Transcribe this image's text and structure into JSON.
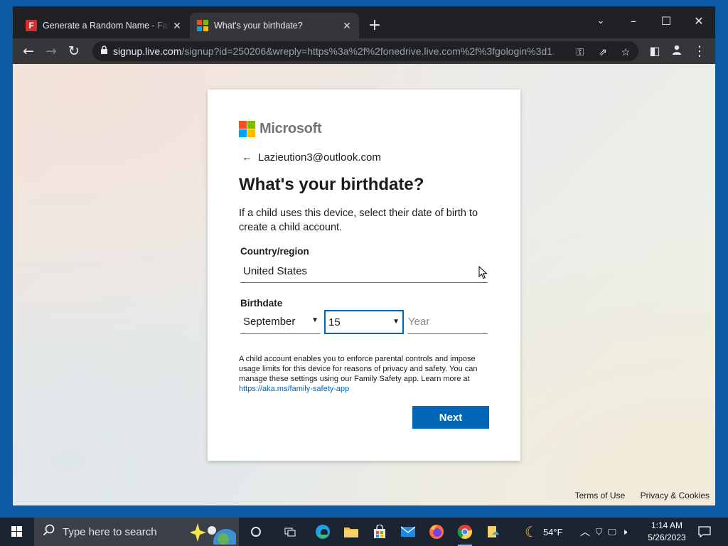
{
  "browser": {
    "tabs": [
      {
        "title": "Generate a Random Name - Fake Name Generator",
        "favicon": "fakename-icon"
      },
      {
        "title": "What's your birthdate?",
        "favicon": "microsoft-icon"
      }
    ],
    "url_host": "signup.live.com",
    "url_rest": "/signup?id=250206&wreply=https%3a%2f%2fonedrive.live.com%2f%3fgologin%3d1..."
  },
  "page": {
    "brand": "Microsoft",
    "account_email": "Lazieution3@outlook.com",
    "heading": "What's your birthdate?",
    "description": "If a child uses this device, select their date of birth to create a child account.",
    "country_label": "Country/region",
    "country_value": "United States",
    "birthdate_label": "Birthdate",
    "month_value": "September",
    "day_value": "15",
    "year_placeholder": "Year",
    "note_text": "A child account enables you to enforce parental controls and impose usage limits for this device for reasons of privacy and safety. You can manage these settings using our Family Safety app. Learn more at",
    "note_link": "https://aka.ms/family-safety-app",
    "next_button": "Next",
    "footer": {
      "terms": "Terms of Use",
      "privacy": "Privacy & Cookies"
    }
  },
  "taskbar": {
    "search_placeholder": "Type here to search",
    "weather": "54°F",
    "time": "1:14 AM",
    "date": "5/26/2023"
  },
  "colors": {
    "accent": "#0067b8",
    "ms_red": "#f25022",
    "ms_green": "#7fba00",
    "ms_blue": "#00a4ef",
    "ms_yellow": "#ffb900"
  }
}
